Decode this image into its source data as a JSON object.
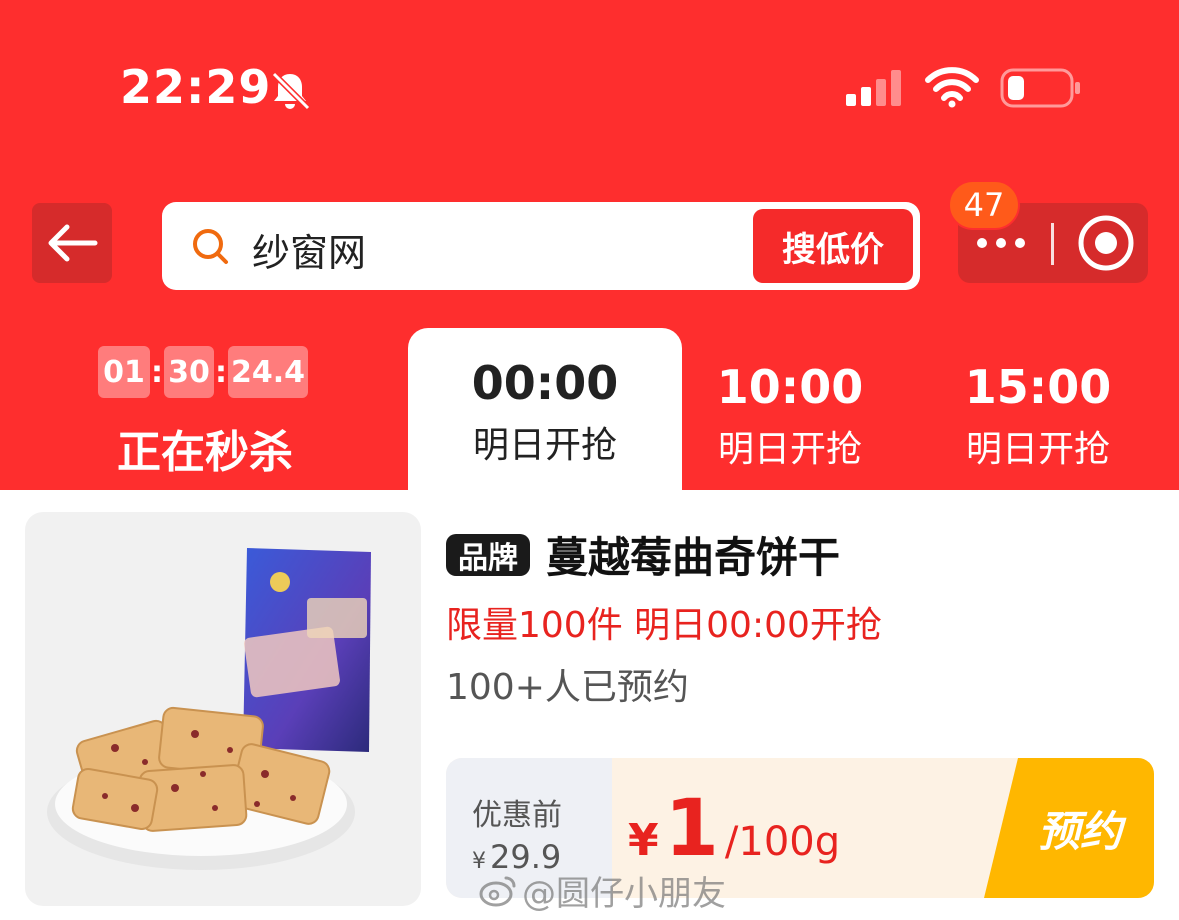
{
  "status_bar": {
    "time": "22:29"
  },
  "nav": {
    "search_query": "纱窗网",
    "search_button": "搜低价",
    "badge_count": "47"
  },
  "sessions": {
    "current": {
      "countdown": [
        "01",
        "30",
        "24.4"
      ],
      "label": "正在秒杀"
    },
    "tabs": [
      {
        "time": "00:00",
        "label": "明日开抢"
      },
      {
        "time": "10:00",
        "label": "明日开抢"
      },
      {
        "time": "15:00",
        "label": "明日开抢"
      }
    ]
  },
  "product": {
    "brand_tag": "品牌",
    "title": "蔓越莓曲奇饼干",
    "limit_text": "限量100件 明日00:00开抢",
    "reserved_text": "100+人已预约",
    "original_label": "优惠前",
    "original_currency": "¥",
    "original_price": "29.9",
    "price_currency": "¥",
    "price": "1",
    "price_unit": "/100g",
    "reserve_button": "预约"
  },
  "watermark": "@圆仔小朋友",
  "colors": {
    "header_red": "#fe2e2e",
    "price_red": "#e8231f",
    "reserve_yellow": "#ffb700",
    "badge_orange": "#ff5a1a"
  }
}
